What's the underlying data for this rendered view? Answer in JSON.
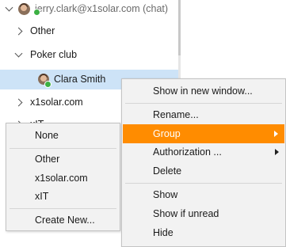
{
  "tree": {
    "account_label": "jerry.clark@x1solar.com (chat)",
    "groups": [
      {
        "label": "Other",
        "expanded": false
      },
      {
        "label": "Poker club",
        "expanded": true
      },
      {
        "label": "x1solar.com",
        "expanded": false
      },
      {
        "label": "xIT",
        "expanded": false
      }
    ],
    "selected_contact": {
      "name": "Clara Smith",
      "status": "online"
    }
  },
  "context_menu": {
    "items": [
      {
        "label": "Show in new window..."
      },
      {
        "label": "Rename..."
      },
      {
        "label": "Group",
        "has_submenu": true,
        "highlighted": true
      },
      {
        "label": "Authorization ...",
        "has_submenu": true
      },
      {
        "label": "Delete"
      },
      {
        "label": "Show"
      },
      {
        "label": "Show if unread"
      },
      {
        "label": "Hide"
      }
    ]
  },
  "group_submenu": {
    "items": [
      {
        "label": "None"
      },
      {
        "label": "Other"
      },
      {
        "label": "x1solar.com"
      },
      {
        "label": "xIT"
      },
      {
        "label": "Create New..."
      }
    ]
  },
  "colors": {
    "highlight": "#ff8c00",
    "selection": "#cde3f7",
    "presence_online": "#3cb043"
  }
}
